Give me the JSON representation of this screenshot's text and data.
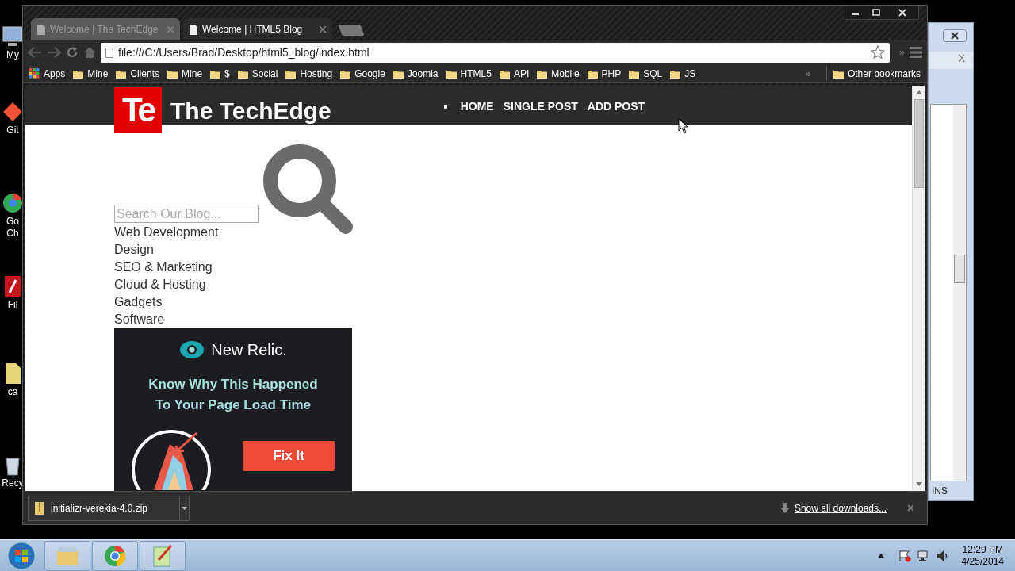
{
  "desktop": {
    "icons": [
      {
        "kind": "computer",
        "lines": [
          "My"
        ]
      },
      {
        "kind": "git",
        "lines": [
          "Git"
        ]
      },
      {
        "kind": "chrome",
        "lines": [
          "Go",
          "Ch"
        ]
      },
      {
        "kind": "pdf",
        "lines": [
          "Fil"
        ]
      },
      {
        "kind": "file",
        "lines": [
          "ca"
        ]
      },
      {
        "kind": "bin",
        "lines": [
          "Recy"
        ]
      }
    ]
  },
  "background_window": {
    "close_label": "X",
    "status": "INS"
  },
  "browser": {
    "tabs": [
      {
        "title": "Welcome | The TechEdge",
        "selected": false
      },
      {
        "title": "Welcome | HTML5 Blog",
        "selected": true
      }
    ],
    "address": "file:///C:/Users/Brad/Desktop/html5_blog/index.html",
    "bookmarks": [
      {
        "kind": "apps",
        "label": "Apps"
      },
      {
        "kind": "folder",
        "label": "Mine"
      },
      {
        "kind": "folder",
        "label": "Clients"
      },
      {
        "kind": "folder",
        "label": "Mine"
      },
      {
        "kind": "folder",
        "label": "$"
      },
      {
        "kind": "folder",
        "label": "Social"
      },
      {
        "kind": "folder",
        "label": "Hosting"
      },
      {
        "kind": "folder",
        "label": "Google"
      },
      {
        "kind": "folder",
        "label": "Joomla"
      },
      {
        "kind": "folder",
        "label": "HTML5"
      },
      {
        "kind": "folder",
        "label": "API"
      },
      {
        "kind": "folder",
        "label": "Mobile"
      },
      {
        "kind": "folder",
        "label": "PHP"
      },
      {
        "kind": "folder",
        "label": "SQL"
      },
      {
        "kind": "folder",
        "label": "JS"
      }
    ],
    "bookmarks_overflow": "»",
    "other_bookmarks": "Other bookmarks",
    "toolbar_overflow": "»"
  },
  "page": {
    "logo_mark": "Te",
    "site_title": "The TechEdge",
    "nav_marker": "■",
    "nav": [
      "HOME",
      "SINGLE POST",
      "ADD POST"
    ],
    "search": {
      "placeholder": "Search Our Blog..."
    },
    "categories": [
      "Web Development",
      "Design",
      "SEO & Marketing",
      "Cloud & Hosting",
      "Gadgets",
      "Software"
    ],
    "ad": {
      "brand": "New Relic.",
      "headline_lines": [
        "Know Why This Happened",
        "To Your Page Load Time"
      ],
      "button": "Fix It"
    }
  },
  "downloads": {
    "file": "initializr-verekia-4.0.zip",
    "show_all": "Show all downloads..."
  },
  "taskbar": {
    "apps": [
      {
        "kind": "explorer"
      },
      {
        "kind": "chrome"
      },
      {
        "kind": "notepad"
      }
    ],
    "time": "12:29 PM",
    "date": "4/25/2014"
  }
}
